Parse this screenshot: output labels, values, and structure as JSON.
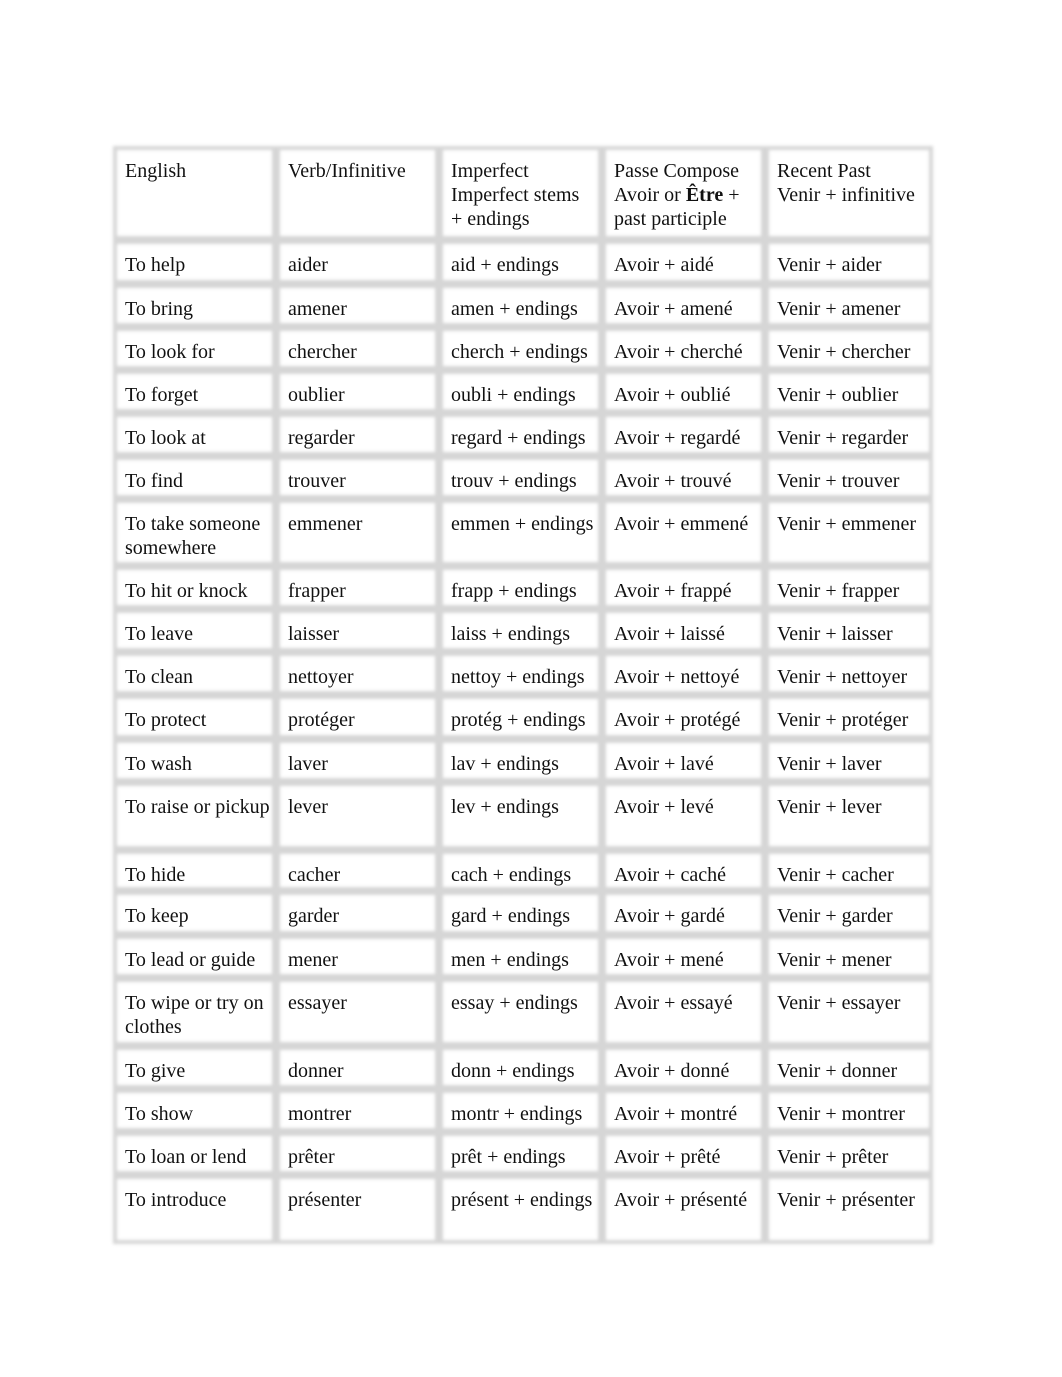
{
  "table": {
    "headers": [
      {
        "line1": "English",
        "line2": "",
        "line3": ""
      },
      {
        "line1": "Verb/Infinitive",
        "line2": "",
        "line3": ""
      },
      {
        "line1": "Imperfect",
        "line2": "Imperfect stems",
        "line3": "+ endings"
      },
      {
        "line1": "Passe Compose",
        "line2_pre": "Avoir or ",
        "line2_bold": "Être",
        "line2_post": " +",
        "line3": "past participle"
      },
      {
        "line1": "Recent Past",
        "line2": "Venir + infinitive",
        "line3": ""
      }
    ],
    "rows": [
      [
        "To help",
        "aider",
        "aid + endings",
        "Avoir + aidé",
        "Venir + aider"
      ],
      [
        "To bring",
        "amener",
        "amen + endings",
        "Avoir + amené",
        "Venir + amener"
      ],
      [
        "To look for",
        "chercher",
        "cherch + endings",
        "Avoir + cherché",
        "Venir + chercher"
      ],
      [
        "To forget",
        "oublier",
        "oubli + endings",
        "Avoir + oublié",
        "Venir + oublier"
      ],
      [
        "To look at",
        "regarder",
        "regard + endings",
        "Avoir + regardé",
        "Venir + regarder"
      ],
      [
        "To find",
        "trouver",
        "trouv + endings",
        "Avoir + trouvé",
        "Venir + trouver"
      ],
      [
        "To take someone somewhere",
        "emmener",
        "emmen + endings",
        "Avoir + emmené",
        "Venir + emmener"
      ],
      [
        "To hit or knock",
        "frapper",
        "frapp + endings",
        "Avoir + frappé",
        "Venir + frapper"
      ],
      [
        "To leave",
        "laisser",
        "laiss + endings",
        "Avoir + laissé",
        "Venir + laisser"
      ],
      [
        "To clean",
        "nettoyer",
        "nettoy + endings",
        "Avoir + nettoyé",
        "Venir + nettoyer"
      ],
      [
        "To protect",
        "protéger",
        "protég + endings",
        "Avoir + protégé",
        "Venir + protéger"
      ],
      [
        "To wash",
        "laver",
        "lav + endings",
        "Avoir + lavé",
        "Venir + laver"
      ],
      [
        "To raise or pickup",
        "lever",
        "lev + endings",
        "Avoir + levé",
        "Venir + lever"
      ],
      [
        "To hide",
        "cacher",
        "cach + endings",
        "Avoir + caché",
        "Venir + cacher"
      ],
      [
        "To keep",
        "garder",
        "gard + endings",
        "Avoir + gardé",
        "Venir + garder"
      ],
      [
        "To lead or guide",
        "mener",
        "men + endings",
        "Avoir + mené",
        "Venir + mener"
      ],
      [
        "To wipe or try on clothes",
        "essayer",
        "essay + endings",
        "Avoir + essayé",
        "Venir + essayer"
      ],
      [
        "To give",
        "donner",
        "donn + endings",
        "Avoir + donné",
        "Venir + donner"
      ],
      [
        "To show",
        "montrer",
        "montr + endings",
        "Avoir + montré",
        "Venir + montrer"
      ],
      [
        "To loan or lend",
        "prêter",
        "prêt + endings",
        "Avoir + prêté",
        "Venir + prêter"
      ],
      [
        "To introduce",
        "présenter",
        "présent + endings",
        "Avoir + présenté",
        "Venir + présenter"
      ]
    ]
  }
}
